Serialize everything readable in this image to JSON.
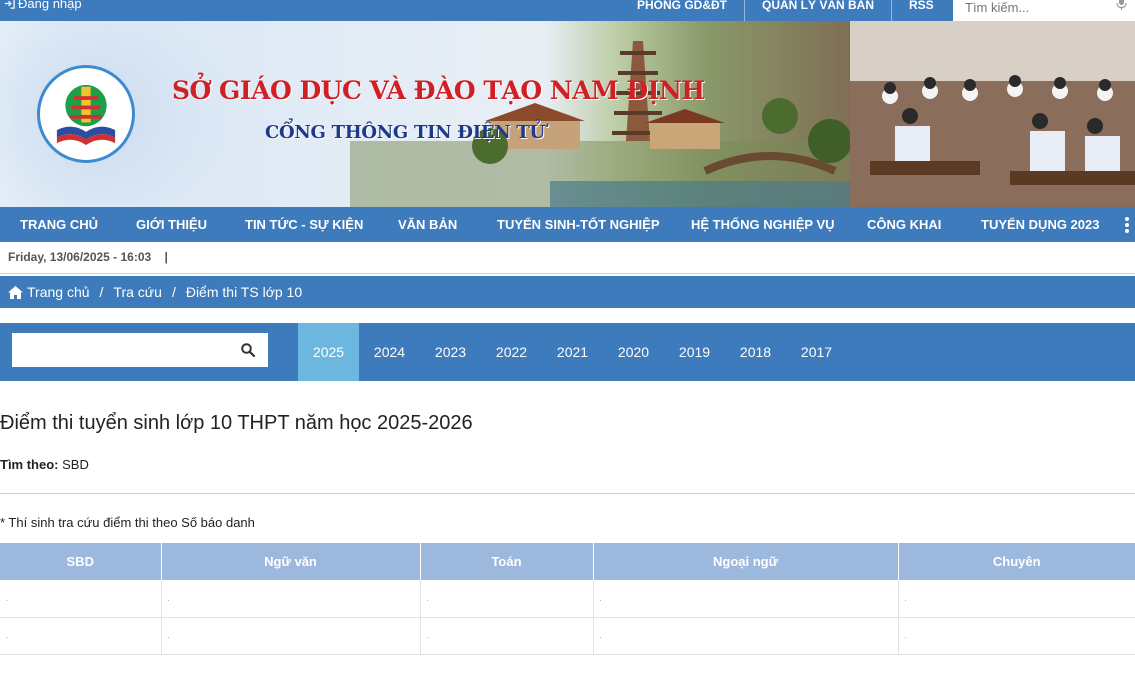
{
  "topbar": {
    "login_label": "Đăng nhập",
    "links": [
      "PHÒNG GD&ĐT",
      "QUẢN LÝ VĂN BẢN",
      "RSS"
    ],
    "search_placeholder": "Tìm kiếm..."
  },
  "banner": {
    "title": "SỞ GIÁO DỤC VÀ ĐÀO TẠO NAM ĐỊNH",
    "subtitle": "CỔNG THÔNG TIN ĐIỆN TỬ"
  },
  "nav": {
    "items": [
      "TRANG CHỦ",
      "GIỚI THIỆU",
      "TIN TỨC - SỰ KIỆN",
      "VĂN BẢN",
      "TUYỂN SINH-TỐT NGHIỆP",
      "HỆ THỐNG NGHIỆP VỤ",
      "CÔNG KHAI",
      "TUYỂN DỤNG 2023"
    ]
  },
  "dateline": "Friday, 13/06/2025 - 16:03    |",
  "breadcrumb": {
    "home": "Trang chủ",
    "level1": "Tra cứu",
    "level2": "Điểm thi TS lớp 10"
  },
  "years": {
    "items": [
      "2025",
      "2024",
      "2023",
      "2022",
      "2021",
      "2020",
      "2019",
      "2018",
      "2017"
    ],
    "selected": "2025"
  },
  "content": {
    "heading": "Điểm thi tuyển sinh lớp 10 THPT năm học 2025-2026",
    "find_label": "Tìm theo:",
    "find_value": "SBD",
    "note": "* Thí sinh tra cứu điểm thi theo Số báo danh"
  },
  "table": {
    "headers": [
      "SBD",
      "Ngữ văn",
      "Toán",
      "Ngoại ngữ",
      "Chuyên"
    ],
    "rows": [
      [
        ".",
        ".",
        ".",
        ".",
        "."
      ],
      [
        ".",
        ".",
        ".",
        ".",
        "."
      ]
    ]
  },
  "colors": {
    "primary": "#3d7bbd",
    "active_year": "#6cb7e0",
    "table_header": "#9cb8dc",
    "title_red": "#d01f25",
    "title_blue": "#1d3a8a"
  }
}
